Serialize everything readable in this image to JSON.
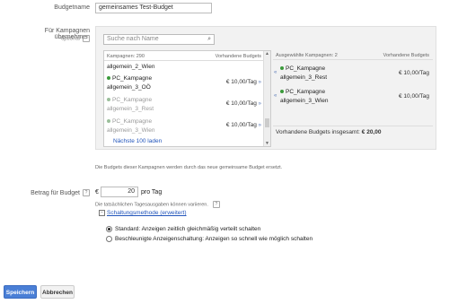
{
  "budget": {
    "name_label": "Budgetname",
    "name_value": "gemeinsames Test-Budget"
  },
  "campaigns": {
    "label_main": "Für Kampagnen übernehmen",
    "label_optional": "optional",
    "search_placeholder": "Suche nach Name",
    "available_header": "Kampagnen: 290",
    "available_budget_header": "Vorhandene Budgets",
    "available": [
      {
        "line1": "",
        "line2": "allgemein_2_Wien",
        "price": "",
        "status": "active"
      },
      {
        "line1": "PC_Kampagne",
        "line2": "allgemein_3_OÖ",
        "price": "€ 10,00/Tag",
        "status": "active"
      },
      {
        "line1": "PC_Kampagne",
        "line2": "allgemein_3_Rest",
        "price": "€ 10,00/Tag",
        "status": "added"
      },
      {
        "line1": "PC_Kampagne",
        "line2": "allgemein_3_Wien",
        "price": "€ 10,00/Tag",
        "status": "added"
      }
    ],
    "next_label": "Nächste 100 laden",
    "selected_header": "Ausgewählte Kampagnen: 2",
    "selected_budget_header": "Vorhandene Budgets",
    "selected": [
      {
        "line1": "PC_Kampagne",
        "line2": "allgemein_3_Rest",
        "price": "€ 10,00/Tag"
      },
      {
        "line1": "PC_Kampagne",
        "line2": "allgemein_3_Wien",
        "price": "€ 10,00/Tag"
      }
    ],
    "total_label": "Vorhandene Budgets insgesamt:",
    "total_value": "€ 20,00",
    "note": "Die Budgets dieser Kampagnen werden durch das neue gemeinsame Budget ersetzt."
  },
  "amount": {
    "label": "Betrag für Budget",
    "currency": "€",
    "value": "20",
    "unit": "pro Tag",
    "hint": "Die tatsächlichen Tagesausgaben können variieren.",
    "delivery_toggle": "Schaltungsmethode (erweitert)",
    "option_standard": "Standard: Anzeigen zeitlich gleichmäßig verteilt schalten",
    "option_accelerated": "Beschleunigte Anzeigenschaltung: Anzeigen so schnell wie möglich schalten"
  },
  "actions": {
    "save": "Speichern",
    "cancel": "Abbrechen"
  },
  "colors": {
    "accent_blue": "#4a7fd6",
    "link_blue": "#2255bb",
    "status_green": "#3a9a3a"
  }
}
